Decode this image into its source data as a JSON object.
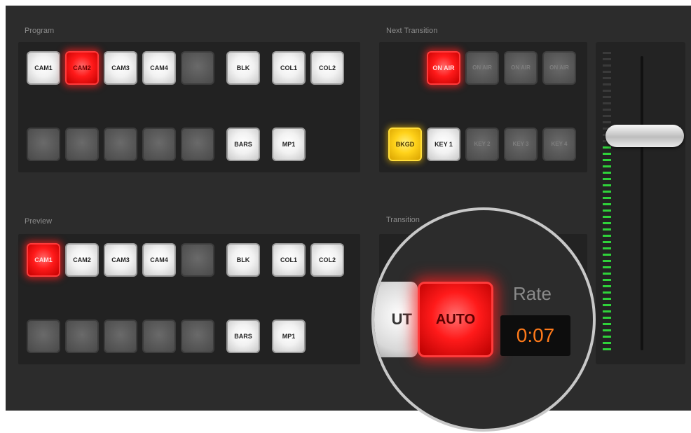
{
  "program": {
    "label": "Program",
    "row1": [
      "CAM1",
      "CAM2",
      "CAM3",
      "CAM4",
      "",
      "BLK",
      "COL1",
      "COL2"
    ],
    "row2": [
      "",
      "",
      "",
      "",
      "",
      "BARS",
      "MP1"
    ],
    "active": "CAM2"
  },
  "preview": {
    "label": "Preview",
    "row1": [
      "CAM1",
      "CAM2",
      "CAM3",
      "CAM4",
      "",
      "BLK",
      "COL1",
      "COL2"
    ],
    "row2": [
      "",
      "",
      "",
      "",
      "",
      "BARS",
      "MP1"
    ],
    "active": "CAM1"
  },
  "next_transition": {
    "label": "Next Transition",
    "on_air": [
      "ON AIR",
      "ON AIR",
      "ON AIR",
      "ON AIR"
    ],
    "layers": [
      "BKGD",
      "KEY 1",
      "KEY 2",
      "KEY 3",
      "KEY 4"
    ]
  },
  "transition": {
    "label": "Transition",
    "cut_label": "UT",
    "auto_label": "AUTO",
    "rate_label": "Rate",
    "rate_value": "0:07"
  },
  "colors": {
    "panel": "#2c2c2c",
    "active_red": "#ff1a1a",
    "bkgd_yellow": "#ffd21a",
    "rate_orange": "#ff7a1a",
    "meter_green": "#2fd23a"
  }
}
